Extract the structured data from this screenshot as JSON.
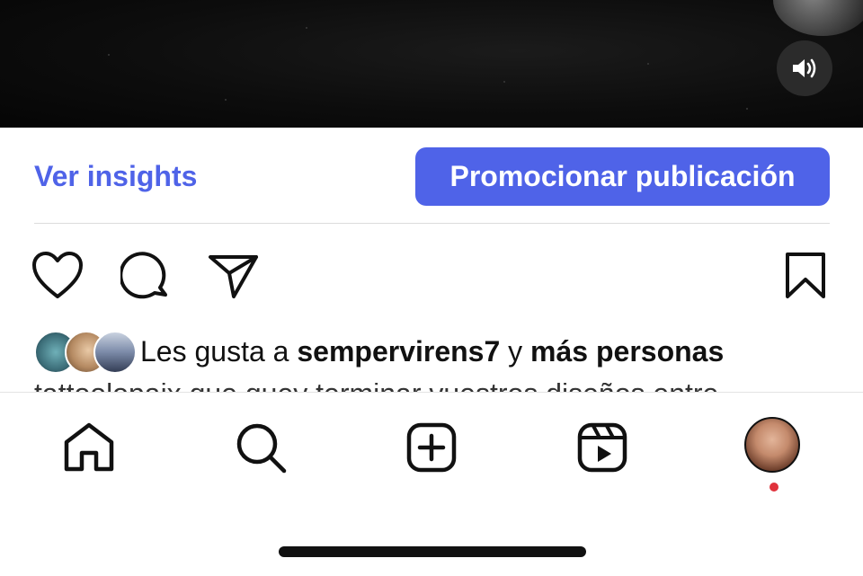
{
  "media": {
    "sound_icon": "speaker-icon"
  },
  "actions_bar": {
    "insights_label": "Ver insights",
    "promote_label": "Promocionar publicación",
    "accent_color": "#4f63e8"
  },
  "post_actions": {
    "like_icon": "heart-icon",
    "comment_icon": "comment-icon",
    "share_icon": "send-icon",
    "save_icon": "bookmark-icon"
  },
  "likes": {
    "prefix": "Les gusta a",
    "user": "sempervirens7",
    "connector": "y",
    "others": "más personas"
  },
  "caption_preview": "tattoolopaix que quey terminar vuestros diseños entre",
  "tab_bar": {
    "items": [
      "home-icon",
      "search-icon",
      "create-icon",
      "reels-icon",
      "profile-avatar"
    ],
    "notification_color": "#e0323c"
  }
}
